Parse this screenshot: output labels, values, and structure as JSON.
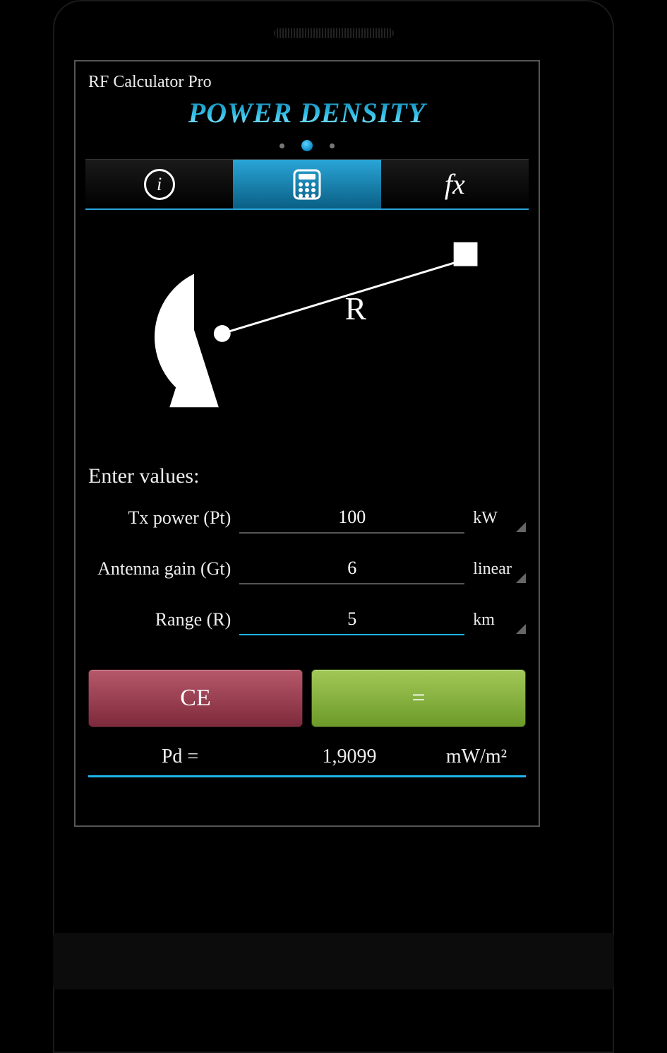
{
  "app": {
    "title": "RF Calculator Pro"
  },
  "page": {
    "title": "Power density"
  },
  "tabs": {
    "info_icon": "info-icon",
    "calc_icon": "calculator-icon",
    "fx_icon": "fx-icon",
    "fx_label": "fx"
  },
  "diagram": {
    "range_label": "R"
  },
  "form_header": "Enter values:",
  "rows": [
    {
      "label": "Tx power (Pt)",
      "value": "100",
      "unit": "kW"
    },
    {
      "label": "Antenna gain (Gt)",
      "value": "6",
      "unit": "linear"
    },
    {
      "label": "Range (R)",
      "value": "5",
      "unit": "km",
      "focused": true
    }
  ],
  "buttons": {
    "ce": "CE",
    "eq": "="
  },
  "result": {
    "label": "Pd =",
    "value": "1,9099",
    "unit": "mW/m²"
  },
  "colors": {
    "accent": "#1fb4ea",
    "ce": "#8d3a4a",
    "eq": "#87b33f"
  }
}
